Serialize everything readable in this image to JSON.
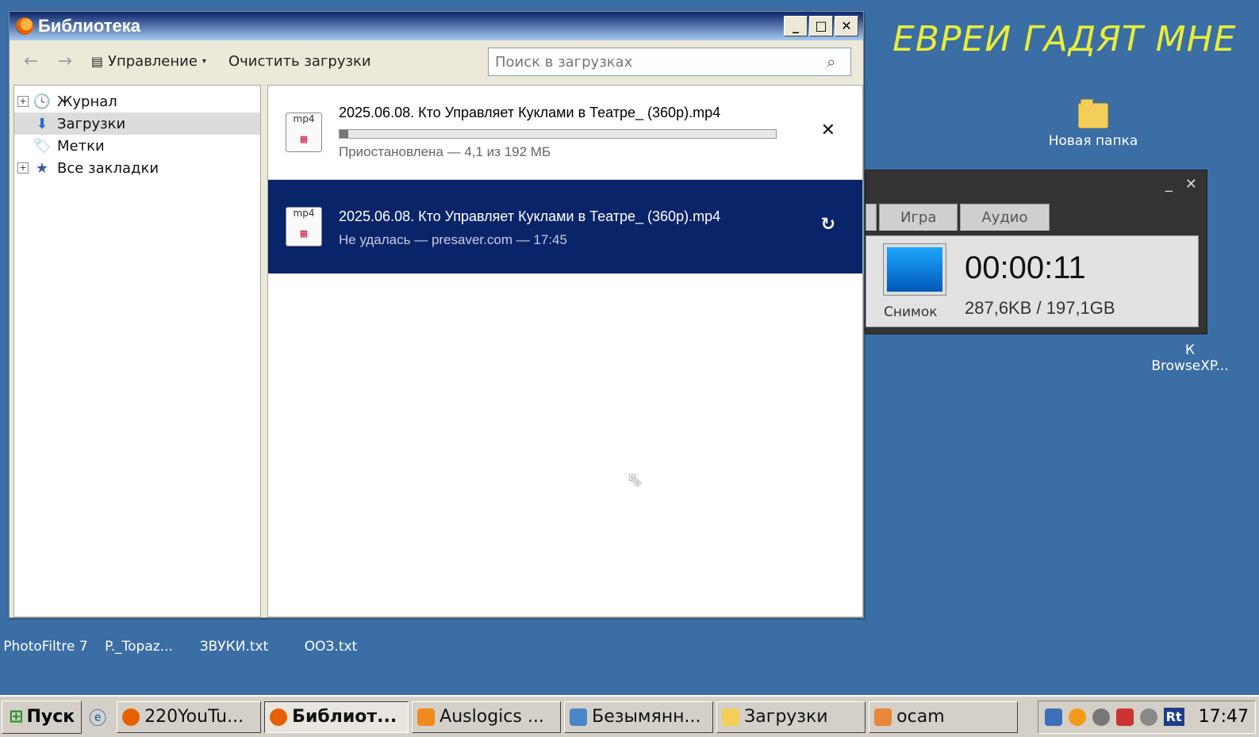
{
  "desktop": {
    "banner": "ЕВРЕИ ГАДЯТ МНЕ",
    "icons": [
      {
        "label": "Новая папка"
      },
      {
        "label": "К"
      },
      {
        "label": "BrowseXP..."
      },
      {
        "label": "PhotoFiltre 7"
      },
      {
        "label": "P._Topaz..."
      },
      {
        "label": "ЗВУКИ.txt"
      },
      {
        "label": "ООЗ.txt"
      }
    ]
  },
  "window": {
    "title": "Библиотека",
    "controls": {
      "minimize": "_",
      "maximize": "□",
      "close": "✕"
    },
    "toolbar": {
      "back": "←",
      "forward": "→",
      "manage": "Управление",
      "clear": "Очистить загрузки",
      "search_placeholder": "Поиск в загрузках"
    },
    "tree": [
      {
        "label": "Журнал",
        "expandable": true
      },
      {
        "label": "Загрузки",
        "selected": true
      },
      {
        "label": "Метки"
      },
      {
        "label": "Все закладки",
        "expandable": true
      }
    ],
    "downloads": [
      {
        "name": "2025.06.08. Кто Управляет Куклами в Театре_ (360р).mp4",
        "status": "Приостановлена —  4,1 из 192 МБ",
        "progress": 0.02,
        "action": "✕"
      },
      {
        "name": "2025.06.08. Кто Управляет Куклами в Театре_ (360р).mp4",
        "status": "Не удалась — presaver.com — 17:45",
        "action": "↻"
      }
    ],
    "file_icon_label": "mp4"
  },
  "ocam": {
    "tabs": [
      "Игра",
      "Аудио"
    ],
    "snapshot": "Снимок",
    "timer": "00:00:11",
    "sizes": "287,6KB / 197,1GB"
  },
  "taskbar": {
    "start": "Пуск",
    "tasks": [
      {
        "label": "220YouTu..."
      },
      {
        "label": "Библиот...",
        "active": true
      },
      {
        "label": "Auslogics ..."
      },
      {
        "label": "Безымянн..."
      },
      {
        "label": "Загрузки"
      },
      {
        "label": "ocam"
      }
    ],
    "tray_rt": "Rt",
    "clock": "17:47"
  }
}
